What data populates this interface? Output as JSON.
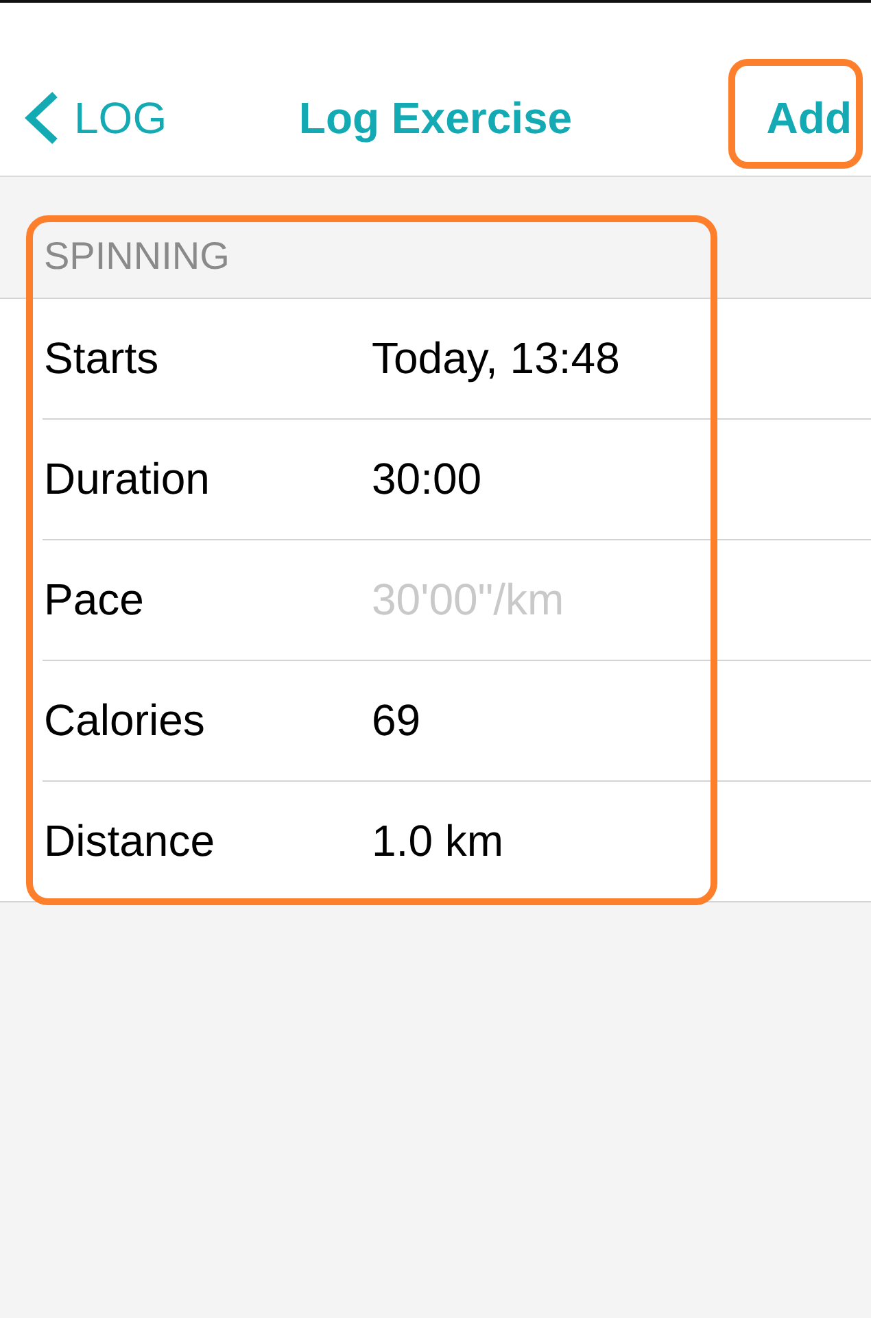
{
  "nav_bar": {
    "back": {
      "label": "LOG"
    },
    "title": "Log Exercise",
    "add": {
      "label": "Add",
      "highlighted": true
    }
  },
  "section": {
    "title": "SPINNING",
    "highlighted": true,
    "rows": [
      {
        "label": "Starts",
        "value": "Today, 13:48"
      },
      {
        "label": "Duration",
        "value": "30:00"
      },
      {
        "label": "Pace",
        "placeholder": "30'00\"/km"
      },
      {
        "label": "Calories",
        "value": "69"
      },
      {
        "label": "Distance",
        "value": "1.0 km"
      }
    ]
  }
}
